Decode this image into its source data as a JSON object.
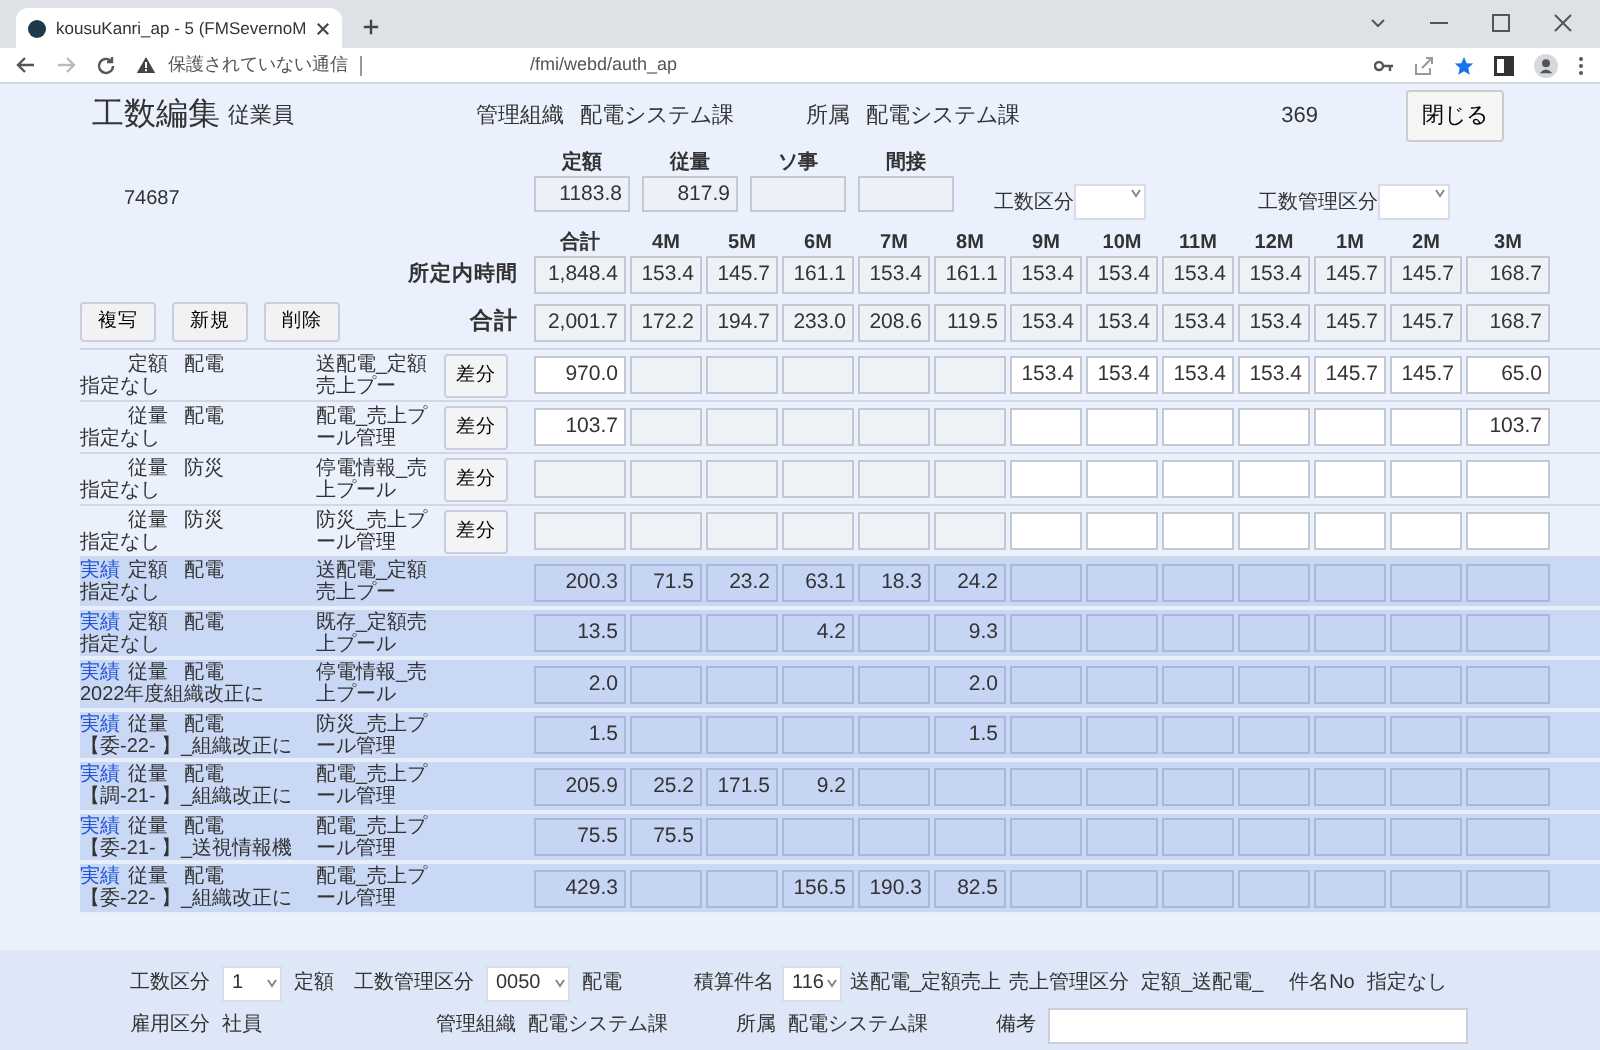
{
  "browser": {
    "tab_title": "kousuKanri_ap - 5 (FMSevernoM",
    "security_label": "保護されていない通信",
    "url": "/fmi/webd/auth_ap"
  },
  "header": {
    "title": "工数編集",
    "employee_label": "従業員",
    "org_label": "管理組織",
    "org_value": "配電システム課",
    "dept_label": "所属",
    "dept_value": "配電システム課",
    "number": "369",
    "close_button": "閉じる"
  },
  "summary": {
    "employee_id": "74687",
    "totals": [
      {
        "label": "定額",
        "value": "1183.8"
      },
      {
        "label": "従量",
        "value": "817.9"
      },
      {
        "label": "ソ事"
      },
      {
        "label": "間接"
      }
    ],
    "filters": [
      {
        "label": "工数区分"
      },
      {
        "label": "工数管理区分"
      }
    ]
  },
  "grid": {
    "columns": [
      {
        "label": "合計"
      },
      {
        "label": "4M",
        "closed": true
      },
      {
        "label": "5M",
        "closed": true
      },
      {
        "label": "6M",
        "closed": true
      },
      {
        "label": "7M",
        "closed": true
      },
      {
        "label": "8M",
        "closed": true
      },
      {
        "label": "9M",
        "closed": false
      },
      {
        "label": "10M",
        "closed": false
      },
      {
        "label": "11M",
        "closed": false
      },
      {
        "label": "12M",
        "closed": false
      },
      {
        "label": "1M",
        "closed": false
      },
      {
        "label": "2M",
        "closed": false
      },
      {
        "label": "3M",
        "closed": false
      }
    ],
    "scheduled_row": {
      "label": "所定内時間",
      "cells": [
        {
          "value": "1,848.4"
        },
        {
          "value": "153.4"
        },
        {
          "value": "145.7"
        },
        {
          "value": "161.1"
        },
        {
          "value": "153.4"
        },
        {
          "value": "161.1"
        },
        {
          "value": "153.4"
        },
        {
          "value": "153.4"
        },
        {
          "value": "153.4"
        },
        {
          "value": "153.4"
        },
        {
          "value": "145.7"
        },
        {
          "value": "145.7"
        },
        {
          "value": "168.7"
        }
      ]
    },
    "total_row": {
      "label": "合計",
      "cells": [
        {
          "value": "2,001.7"
        },
        {
          "value": "172.2"
        },
        {
          "value": "194.7"
        },
        {
          "value": "233.0"
        },
        {
          "value": "208.6"
        },
        {
          "value": "119.5"
        },
        {
          "value": "153.4"
        },
        {
          "value": "153.4"
        },
        {
          "value": "153.4"
        },
        {
          "value": "153.4"
        },
        {
          "value": "145.7"
        },
        {
          "value": "145.7"
        },
        {
          "value": "168.7"
        }
      ]
    },
    "actions": [
      "複写",
      "新規",
      "削除"
    ],
    "rows": [
      {
        "kind": "plan",
        "type": "定額",
        "dept": "配電",
        "note": "指定なし",
        "name": "送配電_定額売上プー",
        "button": "差分",
        "cells": [
          {
            "value": "970.0"
          },
          {},
          {},
          {},
          {},
          {},
          {
            "value": "153.4"
          },
          {
            "value": "153.4"
          },
          {
            "value": "153.4"
          },
          {
            "value": "153.4"
          },
          {
            "value": "145.7"
          },
          {
            "value": "145.7"
          },
          {
            "value": "65.0"
          }
        ]
      },
      {
        "kind": "plan",
        "type": "従量",
        "dept": "配電",
        "note": "指定なし",
        "name": "配電_売上プール管理",
        "button": "差分",
        "cells": [
          {
            "value": "103.7"
          },
          {},
          {},
          {},
          {},
          {},
          {},
          {},
          {},
          {},
          {},
          {},
          {
            "value": "103.7"
          }
        ]
      },
      {
        "kind": "plan",
        "type": "従量",
        "dept": "防災",
        "note": "指定なし",
        "name": "停電情報_売上プール",
        "button": "差分",
        "cells": [
          {},
          {},
          {},
          {},
          {},
          {},
          {},
          {},
          {},
          {},
          {},
          {},
          {}
        ]
      },
      {
        "kind": "plan",
        "type": "従量",
        "dept": "防災",
        "note": "指定なし",
        "name": "防災_売上プール管理",
        "button": "差分",
        "cells": [
          {},
          {},
          {},
          {},
          {},
          {},
          {},
          {},
          {},
          {},
          {},
          {},
          {}
        ]
      },
      {
        "kind": "actual",
        "tag": "実績",
        "type": "定額",
        "dept": "配電",
        "note": "指定なし",
        "name": "送配電_定額売上プー",
        "cells": [
          {
            "value": "200.3"
          },
          {
            "value": "71.5"
          },
          {
            "value": "23.2"
          },
          {
            "value": "63.1"
          },
          {
            "value": "18.3"
          },
          {
            "value": "24.2"
          },
          {},
          {},
          {},
          {},
          {},
          {},
          {}
        ]
      },
      {
        "kind": "actual",
        "tag": "実績",
        "type": "定額",
        "dept": "配電",
        "note": "指定なし",
        "name": "既存_定額売上プール",
        "cells": [
          {
            "value": "13.5"
          },
          {},
          {},
          {
            "value": "4.2"
          },
          {},
          {
            "value": "9.3"
          },
          {},
          {},
          {},
          {},
          {},
          {},
          {}
        ]
      },
      {
        "kind": "actual",
        "tag": "実績",
        "type": "従量",
        "dept": "配電",
        "note": "2022年度組織改正に",
        "name": "停電情報_売上プール",
        "cells": [
          {
            "value": "2.0"
          },
          {},
          {},
          {},
          {},
          {
            "value": "2.0"
          },
          {},
          {},
          {},
          {},
          {},
          {},
          {}
        ]
      },
      {
        "kind": "actual",
        "tag": "実績",
        "type": "従量",
        "dept": "配電",
        "note": "【委-22- 】_組織改正に",
        "name": "防災_売上プール管理",
        "cells": [
          {
            "value": "1.5"
          },
          {},
          {},
          {},
          {},
          {
            "value": "1.5"
          },
          {},
          {},
          {},
          {},
          {},
          {},
          {}
        ]
      },
      {
        "kind": "actual",
        "tag": "実績",
        "type": "従量",
        "dept": "配電",
        "note": "【調-21- 】_組織改正に",
        "name": "配電_売上プール管理",
        "cells": [
          {
            "value": "205.9"
          },
          {
            "value": "25.2"
          },
          {
            "value": "171.5"
          },
          {
            "value": "9.2"
          },
          {},
          {},
          {},
          {},
          {},
          {},
          {},
          {},
          {}
        ]
      },
      {
        "kind": "actual",
        "tag": "実績",
        "type": "従量",
        "dept": "配電",
        "note": "【委-21- 】_送視情報機",
        "name": "配電_売上プール管理",
        "cells": [
          {
            "value": "75.5"
          },
          {
            "value": "75.5"
          },
          {},
          {},
          {},
          {},
          {},
          {},
          {},
          {},
          {},
          {},
          {}
        ]
      },
      {
        "kind": "actual",
        "tag": "実績",
        "type": "従量",
        "dept": "配電",
        "note": "【委-22- 】_組織改正に",
        "name": "配電_売上プール管理",
        "cells": [
          {
            "value": "429.3"
          },
          {},
          {},
          {
            "value": "156.5"
          },
          {
            "value": "190.3"
          },
          {
            "value": "82.5"
          },
          {},
          {},
          {},
          {},
          {},
          {},
          {}
        ]
      }
    ]
  },
  "footer": {
    "rows": [
      [
        {
          "kind": "select",
          "label": "工数区分",
          "value": "1",
          "caption": "定額"
        },
        {
          "kind": "select",
          "label": "工数管理区分",
          "value": "0050",
          "caption": "配電"
        },
        {
          "kind": "select",
          "label": "積算件名",
          "value": "116",
          "caption": "送配電_定額売上"
        },
        {
          "kind": "text",
          "label": "売上管理区分",
          "value": "定額_送配電_"
        },
        {
          "kind": "note",
          "label": "件名No",
          "value": "指定なし"
        }
      ],
      [
        {
          "kind": "text",
          "label": "雇用区分",
          "value": "社員"
        },
        {
          "kind": "text",
          "label": "管理組織",
          "value": "配電システム課"
        },
        {
          "kind": "text",
          "label": "所属",
          "value": "配電システム課"
        },
        {
          "kind": "input",
          "label": "備考"
        }
      ]
    ]
  }
}
